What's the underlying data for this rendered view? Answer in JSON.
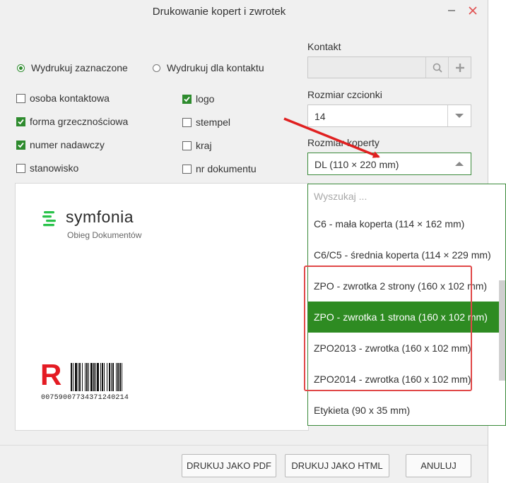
{
  "dialog": {
    "title": "Drukowanie kopert i zwrotek"
  },
  "print_mode": {
    "selected_label": "Wydrukuj zaznaczone",
    "contact_label": "Wydrukuj dla kontaktu"
  },
  "options": [
    {
      "label": "osoba kontaktowa",
      "checked": false
    },
    {
      "label": "forma grzecznościowa",
      "checked": true
    },
    {
      "label": "numer nadawczy",
      "checked": true
    },
    {
      "label": "stanowisko",
      "checked": false
    },
    {
      "label": "logo",
      "checked": true
    },
    {
      "label": "stempel",
      "checked": false
    },
    {
      "label": "kraj",
      "checked": false
    },
    {
      "label": "nr dokumentu",
      "checked": false
    }
  ],
  "contact": {
    "label": "Kontakt",
    "value": ""
  },
  "font_size": {
    "label": "Rozmiar czcionki",
    "value": "14"
  },
  "envelope_size": {
    "label": "Rozmiar koperty",
    "value": "DL (110 × 220 mm)"
  },
  "dropdown": {
    "search_placeholder": "Wyszukaj ...",
    "items": [
      "C6 - mała koperta (114 × 162 mm)",
      "C6/C5 - średnia koperta (114 × 229 mm)",
      "ZPO - zwrotka 2 strony (160 x 102 mm)",
      "ZPO - zwrotka 1 strona (160 x 102 mm)",
      "ZPO2013 - zwrotka (160 x 102 mm)",
      "ZPO2014 - zwrotka (160 x 102 mm)",
      "Etykieta (90 x 35 mm)"
    ],
    "selected_index": 3
  },
  "preview": {
    "logo_text": "symfonia",
    "logo_subtitle": "Obieg Dokumentów",
    "registered_mark": "R",
    "barcode_number": "00759007734371240214"
  },
  "buttons": {
    "print_pdf": "DRUKUJ JAKO PDF",
    "print_html": "DRUKUJ JAKO HTML",
    "cancel": "ANULUJ"
  },
  "colors": {
    "accent": "#2e8b22",
    "annotation": "#e04848"
  },
  "icons": {
    "minimize": "minimize-icon",
    "close": "close-icon",
    "search": "search-icon",
    "add": "plus-icon",
    "dropdown": "chevron-down-icon",
    "dropup": "chevron-up-icon"
  }
}
